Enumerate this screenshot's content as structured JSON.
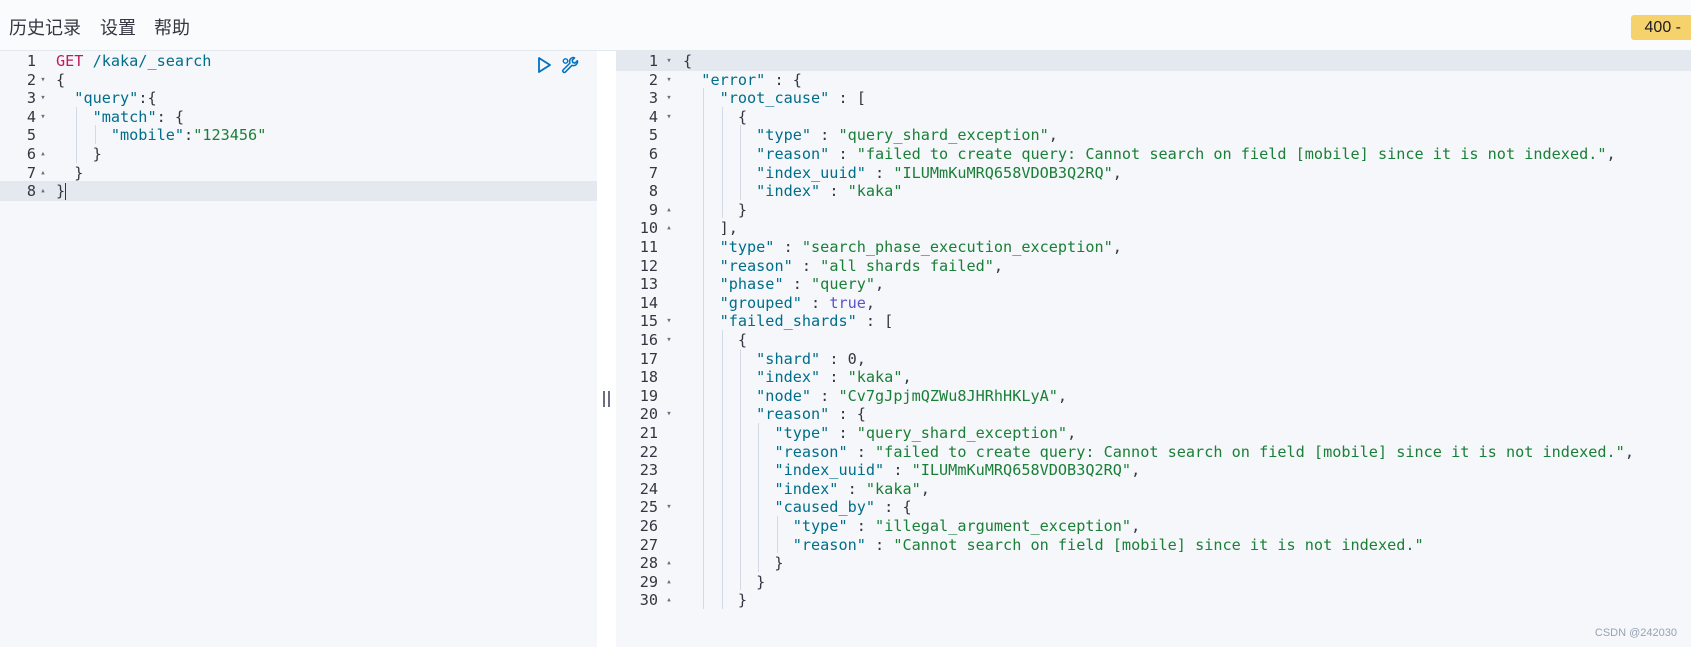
{
  "menu": [
    "历史记录",
    "设置",
    "帮助"
  ],
  "status_badge": "400 -",
  "watermark": "CSDN @242030",
  "request": {
    "lines": [
      [
        [
          "GET",
          "tok-method"
        ],
        [
          " /kaka/_search",
          "tok-path"
        ]
      ],
      [
        [
          "{",
          ""
        ]
      ],
      [
        [
          "  ",
          ""
        ],
        [
          "\"query\"",
          "tok-key"
        ],
        [
          ":{",
          ""
        ]
      ],
      [
        [
          "    ",
          ""
        ],
        [
          "\"match\"",
          "tok-key"
        ],
        [
          ": {",
          ""
        ]
      ],
      [
        [
          "      ",
          ""
        ],
        [
          "\"mobile\"",
          "tok-key"
        ],
        [
          ":",
          ""
        ],
        [
          "\"123456\"",
          "tok-str"
        ]
      ],
      [
        [
          "    }",
          ""
        ]
      ],
      [
        [
          "  }",
          ""
        ]
      ],
      [
        [
          "}",
          ""
        ]
      ]
    ],
    "folds": [
      "",
      "▾",
      "▾",
      "▾",
      "",
      "▴",
      "▴",
      "▴"
    ]
  },
  "response": {
    "start_line": 1,
    "lines": [
      [
        [
          "{",
          ""
        ]
      ],
      [
        [
          "  ",
          ""
        ],
        [
          "\"error\"",
          "tok-key"
        ],
        [
          " : {",
          ""
        ]
      ],
      [
        [
          "    ",
          ""
        ],
        [
          "\"root_cause\"",
          "tok-key"
        ],
        [
          " : [",
          ""
        ]
      ],
      [
        [
          "      {",
          ""
        ]
      ],
      [
        [
          "        ",
          ""
        ],
        [
          "\"type\"",
          "tok-key"
        ],
        [
          " : ",
          ""
        ],
        [
          "\"query_shard_exception\"",
          "tok-str"
        ],
        [
          ",",
          ""
        ]
      ],
      [
        [
          "        ",
          ""
        ],
        [
          "\"reason\"",
          "tok-key"
        ],
        [
          " : ",
          ""
        ],
        [
          "\"failed to create query: Cannot search on field [mobile] since it is not indexed.\"",
          "tok-str"
        ],
        [
          ",",
          ""
        ]
      ],
      [
        [
          "        ",
          ""
        ],
        [
          "\"index_uuid\"",
          "tok-key"
        ],
        [
          " : ",
          ""
        ],
        [
          "\"ILUMmKuMRQ658VDOB3Q2RQ\"",
          "tok-str"
        ],
        [
          ",",
          ""
        ]
      ],
      [
        [
          "        ",
          ""
        ],
        [
          "\"index\"",
          "tok-key"
        ],
        [
          " : ",
          ""
        ],
        [
          "\"kaka\"",
          "tok-str"
        ]
      ],
      [
        [
          "      }",
          ""
        ]
      ],
      [
        [
          "    ],",
          ""
        ]
      ],
      [
        [
          "    ",
          ""
        ],
        [
          "\"type\"",
          "tok-key"
        ],
        [
          " : ",
          ""
        ],
        [
          "\"search_phase_execution_exception\"",
          "tok-str"
        ],
        [
          ",",
          ""
        ]
      ],
      [
        [
          "    ",
          ""
        ],
        [
          "\"reason\"",
          "tok-key"
        ],
        [
          " : ",
          ""
        ],
        [
          "\"all shards failed\"",
          "tok-str"
        ],
        [
          ",",
          ""
        ]
      ],
      [
        [
          "    ",
          ""
        ],
        [
          "\"phase\"",
          "tok-key"
        ],
        [
          " : ",
          ""
        ],
        [
          "\"query\"",
          "tok-str"
        ],
        [
          ",",
          ""
        ]
      ],
      [
        [
          "    ",
          ""
        ],
        [
          "\"grouped\"",
          "tok-key"
        ],
        [
          " : ",
          ""
        ],
        [
          "true",
          "tok-bool"
        ],
        [
          ",",
          ""
        ]
      ],
      [
        [
          "    ",
          ""
        ],
        [
          "\"failed_shards\"",
          "tok-key"
        ],
        [
          " : [",
          ""
        ]
      ],
      [
        [
          "      {",
          ""
        ]
      ],
      [
        [
          "        ",
          ""
        ],
        [
          "\"shard\"",
          "tok-key"
        ],
        [
          " : ",
          ""
        ],
        [
          "0",
          "tok-num"
        ],
        [
          ",",
          ""
        ]
      ],
      [
        [
          "        ",
          ""
        ],
        [
          "\"index\"",
          "tok-key"
        ],
        [
          " : ",
          ""
        ],
        [
          "\"kaka\"",
          "tok-str"
        ],
        [
          ",",
          ""
        ]
      ],
      [
        [
          "        ",
          ""
        ],
        [
          "\"node\"",
          "tok-key"
        ],
        [
          " : ",
          ""
        ],
        [
          "\"Cv7gJpjmQZWu8JHRhHKLyA\"",
          "tok-str"
        ],
        [
          ",",
          ""
        ]
      ],
      [
        [
          "        ",
          ""
        ],
        [
          "\"reason\"",
          "tok-key"
        ],
        [
          " : {",
          ""
        ]
      ],
      [
        [
          "          ",
          ""
        ],
        [
          "\"type\"",
          "tok-key"
        ],
        [
          " : ",
          ""
        ],
        [
          "\"query_shard_exception\"",
          "tok-str"
        ],
        [
          ",",
          ""
        ]
      ],
      [
        [
          "          ",
          ""
        ],
        [
          "\"reason\"",
          "tok-key"
        ],
        [
          " : ",
          ""
        ],
        [
          "\"failed to create query: Cannot search on field [mobile] since it is not indexed.\"",
          "tok-str"
        ],
        [
          ",",
          ""
        ]
      ],
      [
        [
          "          ",
          ""
        ],
        [
          "\"index_uuid\"",
          "tok-key"
        ],
        [
          " : ",
          ""
        ],
        [
          "\"ILUMmKuMRQ658VDOB3Q2RQ\"",
          "tok-str"
        ],
        [
          ",",
          ""
        ]
      ],
      [
        [
          "          ",
          ""
        ],
        [
          "\"index\"",
          "tok-key"
        ],
        [
          " : ",
          ""
        ],
        [
          "\"kaka\"",
          "tok-str"
        ],
        [
          ",",
          ""
        ]
      ],
      [
        [
          "          ",
          ""
        ],
        [
          "\"caused_by\"",
          "tok-key"
        ],
        [
          " : {",
          ""
        ]
      ],
      [
        [
          "            ",
          ""
        ],
        [
          "\"type\"",
          "tok-key"
        ],
        [
          " : ",
          ""
        ],
        [
          "\"illegal_argument_exception\"",
          "tok-str"
        ],
        [
          ",",
          ""
        ]
      ],
      [
        [
          "            ",
          ""
        ],
        [
          "\"reason\"",
          "tok-key"
        ],
        [
          " : ",
          ""
        ],
        [
          "\"Cannot search on field [mobile] since it is not indexed.\"",
          "tok-str"
        ]
      ],
      [
        [
          "          }",
          ""
        ]
      ],
      [
        [
          "        }",
          ""
        ]
      ],
      [
        [
          "      }",
          ""
        ]
      ]
    ],
    "folds": [
      "▾",
      "▾",
      "▾",
      "▾",
      "",
      "",
      "",
      "",
      "▴",
      "▴",
      "",
      "",
      "",
      "",
      "▾",
      "▾",
      "",
      "",
      "",
      "▾",
      "",
      "",
      "",
      "",
      "▾",
      "",
      "",
      "▴",
      "▴",
      "▴"
    ]
  },
  "icons": {
    "send": "play-icon",
    "settings": "wrench-icon"
  }
}
